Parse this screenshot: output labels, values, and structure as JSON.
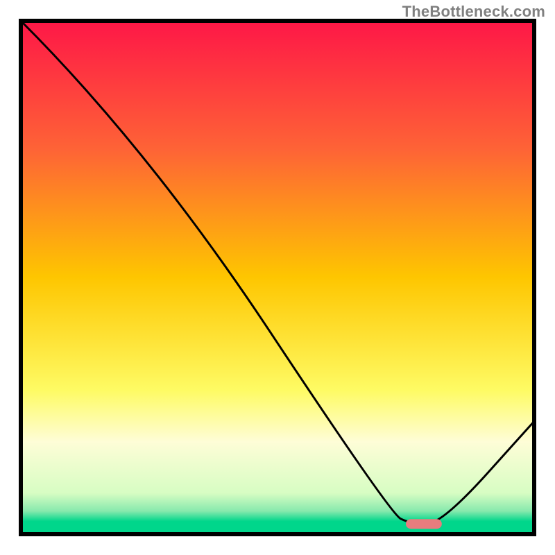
{
  "watermark": "TheBottleneck.com",
  "chart_data": {
    "type": "line",
    "title": "",
    "xlabel": "",
    "ylabel": "",
    "xlim": [
      0,
      100
    ],
    "ylim": [
      0,
      100
    ],
    "series": [
      {
        "name": "bottleneck-curve",
        "x": [
          0,
          25,
          72,
          76,
          82,
          100
        ],
        "values": [
          100,
          75,
          4,
          2,
          2,
          22
        ]
      }
    ],
    "marker": {
      "name": "optimal-point",
      "x_range": [
        75,
        82
      ],
      "y": 2,
      "color": "#e77c7e"
    },
    "gradient_stops": [
      {
        "pos": 0.0,
        "color": "#fe1747"
      },
      {
        "pos": 0.25,
        "color": "#fe6336"
      },
      {
        "pos": 0.5,
        "color": "#fec600"
      },
      {
        "pos": 0.72,
        "color": "#fefb64"
      },
      {
        "pos": 0.82,
        "color": "#fefdd7"
      },
      {
        "pos": 0.92,
        "color": "#d7fdc3"
      },
      {
        "pos": 0.955,
        "color": "#87e9ad"
      },
      {
        "pos": 0.975,
        "color": "#00d68b"
      },
      {
        "pos": 1.0,
        "color": "#00d68b"
      }
    ]
  }
}
